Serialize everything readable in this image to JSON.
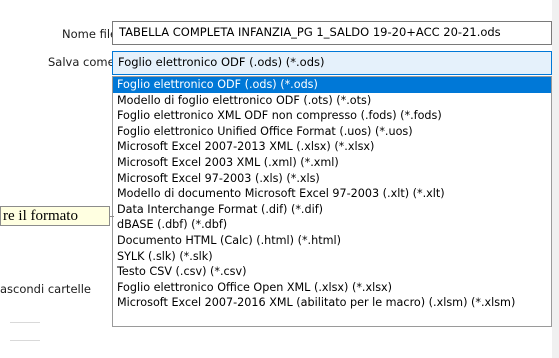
{
  "labels": {
    "filename": "Nome file:",
    "save_as": "Salva come:",
    "hide_folders": "ascondi cartelle"
  },
  "filename_value": "TABELLA COMPLETA INFANZIA_PG 1_SALDO 19-20+ACC 20-21.ods",
  "save_as_selected": "Foglio elettronico ODF (.ods) (*.ods)",
  "dropdown_items": [
    "Foglio elettronico ODF (.ods) (*.ods)",
    "Modello di foglio elettronico ODF (.ots) (*.ots)",
    "Foglio elettronico XML ODF non compresso (.fods) (*.fods)",
    "Foglio elettronico Unified Office Format (.uos) (*.uos)",
    "Microsoft Excel 2007-2013 XML (.xlsx) (*.xlsx)",
    "Microsoft Excel 2003 XML (.xml) (*.xml)",
    "Microsoft Excel 97-2003 (.xls) (*.xls)",
    "Modello di documento Microsoft Excel 97-2003 (.xlt) (*.xlt)",
    "Data Interchange Format (.dif) (*.dif)",
    "dBASE (.dbf) (*.dbf)",
    "Documento HTML (Calc) (.html) (*.html)",
    "SYLK (.slk) (*.slk)",
    "Testo CSV (.csv) (*.csv)",
    "Foglio elettronico Office Open XML (.xlsx) (*.xlsx)",
    "Microsoft Excel 2007-2016 XML (abilitato per le macro) (.xlsm) (*.xlsm)"
  ],
  "selected_index": 0,
  "tooltip_text": "re il formato",
  "colors": {
    "selection": "#0078d7",
    "select_box_bg": "#e5f1fb",
    "tooltip_bg": "#ffffe1"
  }
}
